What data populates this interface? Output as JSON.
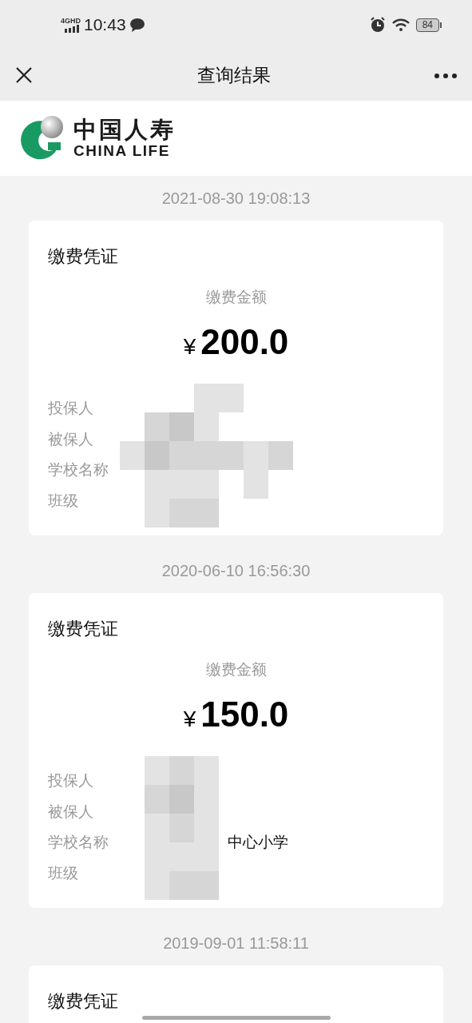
{
  "status_bar": {
    "network": "4GHD",
    "time": "10:43",
    "battery": "84"
  },
  "nav": {
    "title": "查询结果"
  },
  "brand": {
    "name": "中国人寿",
    "name_en": "CHINA LIFE"
  },
  "records": [
    {
      "timestamp": "2021-08-30 19:08:13",
      "title": "缴费凭证",
      "amount_label": "缴费金额",
      "currency": "¥",
      "amount": "200.0",
      "redacted": true,
      "fields": [
        {
          "label": "投保人"
        },
        {
          "label": "被保人"
        },
        {
          "label": "学校名称"
        },
        {
          "label": "班级"
        }
      ]
    },
    {
      "timestamp": "2020-06-10 16:56:30",
      "title": "缴费凭证",
      "amount_label": "缴费金额",
      "currency": "¥",
      "amount": "150.0",
      "redacted": true,
      "fields": [
        {
          "label": "投保人"
        },
        {
          "label": "被保人"
        },
        {
          "label": "学校名称",
          "value": "中心小学"
        },
        {
          "label": "班级"
        }
      ]
    },
    {
      "timestamp": "2019-09-01 11:58:11",
      "title": "缴费凭证",
      "redacted": false
    }
  ]
}
